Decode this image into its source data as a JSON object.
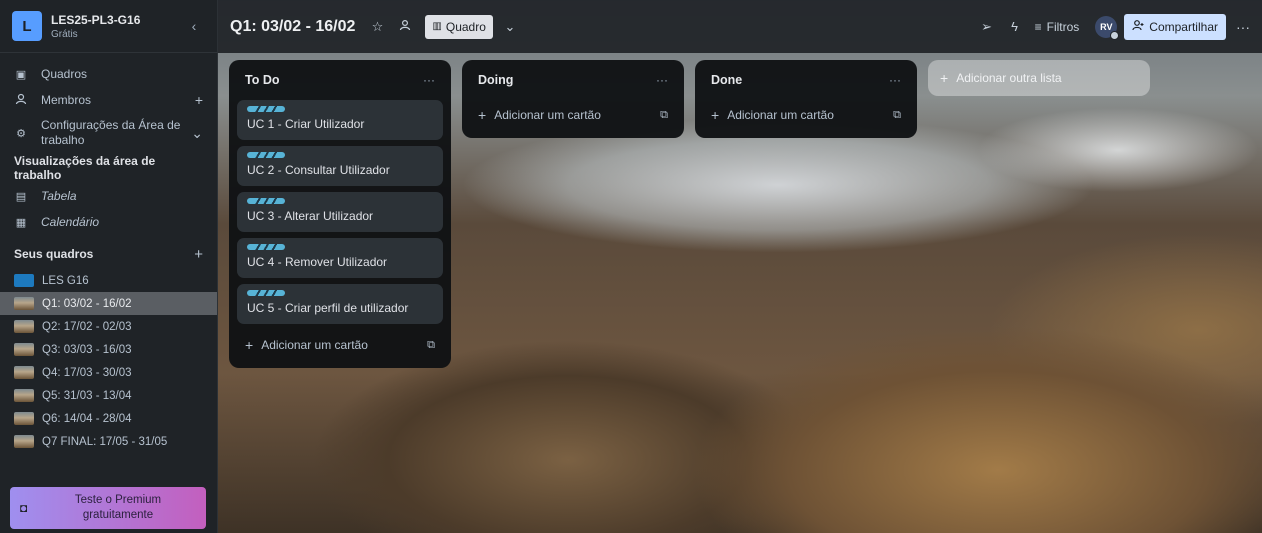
{
  "workspace": {
    "logo_letter": "L",
    "name": "LES25-PL3-G16",
    "plan": "Grátis",
    "collapse_icon": "chevron-left-icon"
  },
  "sidebar": {
    "nav": [
      {
        "label": "Quadros",
        "icon": "board-icon"
      },
      {
        "label": "Membros",
        "icon": "members-icon",
        "trail": "+"
      },
      {
        "label": "Configurações da Área de trabalho",
        "icon": "gear-icon",
        "trail": "⌄"
      }
    ],
    "views_heading": "Visualizações da área de trabalho",
    "views": [
      {
        "label": "Tabela",
        "icon": "table-icon"
      },
      {
        "label": "Calendário",
        "icon": "calendar-icon"
      }
    ],
    "boards_heading": "Seus quadros",
    "boards_add": "+",
    "boards": [
      {
        "label": "LES G16",
        "thumb": "blue",
        "active": false
      },
      {
        "label": "Q1: 03/02 - 16/02",
        "thumb": "mountain",
        "active": true
      },
      {
        "label": "Q2: 17/02 - 02/03",
        "thumb": "mountain",
        "active": false
      },
      {
        "label": "Q3: 03/03 - 16/03",
        "thumb": "mountain",
        "active": false
      },
      {
        "label": "Q4: 17/03 - 30/03",
        "thumb": "mountain",
        "active": false
      },
      {
        "label": "Q5: 31/03 - 13/04",
        "thumb": "mountain",
        "active": false
      },
      {
        "label": "Q6: 14/04 - 28/04",
        "thumb": "mountain",
        "active": false
      },
      {
        "label": "Q7 FINAL: 17/05 - 31/05",
        "thumb": "mountain",
        "active": false
      }
    ],
    "premium": {
      "label": "Teste o Premium gratuitamente",
      "icon": "premium-icon"
    }
  },
  "header": {
    "board_title": "Q1: 03/02 - 16/02",
    "view_label": "Quadro",
    "filters_label": "Filtros",
    "avatar_initials": "RV",
    "share_label": "Compartilhar",
    "more": "···"
  },
  "lists": [
    {
      "title": "To Do",
      "more": "···",
      "cards": [
        {
          "title": "UC 1 - Criar Utilizador"
        },
        {
          "title": "UC 2 - Consultar Utilizador"
        },
        {
          "title": "UC 3 - Alterar Utilizador"
        },
        {
          "title": "UC 4 - Remover Utilizador"
        },
        {
          "title": "UC 5 - Criar perfil de utilizador"
        }
      ],
      "add_card": "Adicionar um cartão"
    },
    {
      "title": "Doing",
      "more": "···",
      "cards": [],
      "add_card": "Adicionar um cartão"
    },
    {
      "title": "Done",
      "more": "···",
      "cards": [],
      "add_card": "Adicionar um cartão"
    }
  ],
  "add_list_label": "Adicionar outra lista",
  "colors": {
    "accent": "#579dff",
    "card_label": "#57b3d6",
    "premium_start": "#9f8fef",
    "premium_end": "#c35fbe"
  }
}
